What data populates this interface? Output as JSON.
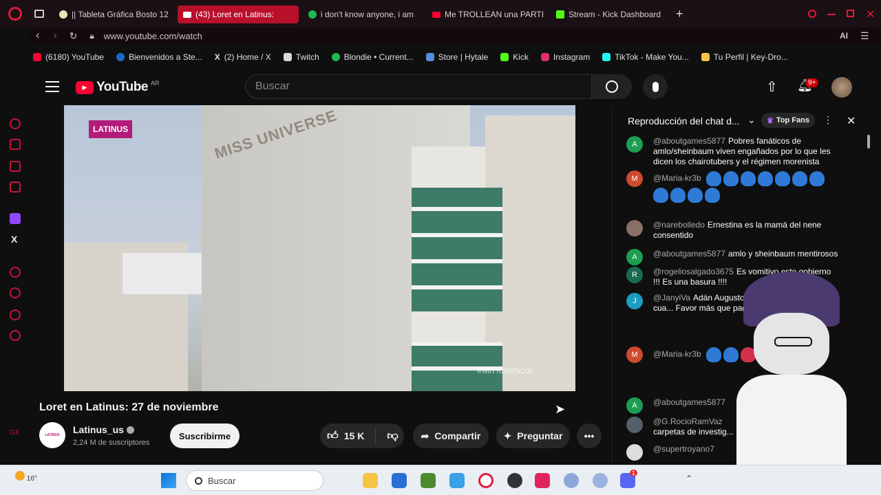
{
  "browser": {
    "tabs": [
      {
        "label": "|| Tableta Gráfica Bosto 12",
        "color": "#e8e3b8"
      },
      {
        "label": "(43) Loret en Latinus:",
        "color": "#ff0033",
        "active": true
      },
      {
        "label": "i don't know anyone, i am",
        "color": "#1db954"
      },
      {
        "label": "Me TROLLEAN una PARTI",
        "color": "#ff0033"
      },
      {
        "label": "Stream - Kick Dashboard",
        "color": "#53fc18"
      }
    ],
    "new_tab": "+",
    "url": "www.youtube.com/watch",
    "bookmarks": [
      {
        "label": "(6180) YouTube",
        "color": "#ff0033"
      },
      {
        "label": "Bienvenidos a Ste...",
        "color": "#1b6ac9"
      },
      {
        "label": "(2) Home / X",
        "color": "#ffffff"
      },
      {
        "label": "Twitch",
        "color": "#9146ff"
      },
      {
        "label": "Blondie • Current...",
        "color": "#1db954"
      },
      {
        "label": "Store | Hytale",
        "color": "#5b8ad6"
      },
      {
        "label": "Kick",
        "color": "#53fc18"
      },
      {
        "label": "Instagram",
        "color": "#e1306c"
      },
      {
        "label": "TikTok - Make You...",
        "color": "#25f4ee"
      },
      {
        "label": "Tu Perfil | Key-Dro...",
        "color": "#f5c542"
      }
    ],
    "ai_label": "AI"
  },
  "youtube": {
    "logo": "YouTube",
    "region": "AR",
    "search_placeholder": "Buscar",
    "notif_count": "9+",
    "video": {
      "watermark_brand": "LATINUS",
      "watermark_handle": "#MrHuachicol",
      "building_sign": "MISS UNIVERSE"
    },
    "title": "Loret en Latinus: 27 de noviembre",
    "channel": {
      "name": "Latinus_us",
      "subs": "2,24 M de suscriptores",
      "avatar_text": "LATINUS"
    },
    "subscribe": "Suscribirme",
    "likes": "15 K",
    "share": "Compartir",
    "ask": "Preguntar"
  },
  "chat": {
    "title": "Reproducción del chat d...",
    "top_fans": "Top Fans",
    "messages": [
      {
        "avatar": "A",
        "color": "#1e9e53",
        "author": "@aboutgames5877",
        "text": "Pobres fanáticos de amlo/sheinbaum viven engañados por lo que les dicen los chairotubers y el régimen morenista"
      },
      {
        "avatar": "M",
        "color": "#d04a2e",
        "author": "@Maria-kr3b",
        "text": ""
      },
      {
        "avatar": "",
        "color": "#8a6f69",
        "author": "@narebolledo",
        "text": "Ernestina es la mamá del nene consentido"
      },
      {
        "avatar": "A",
        "color": "#1e9e53",
        "author": "@aboutgames5877",
        "text": "amlo y sheinbaum mentirosos"
      },
      {
        "avatar": "R",
        "color": "#1b6b52",
        "author": "@rogeliosalgado3675",
        "text": "Es vomitivo este gobierno !!! Es una basura !!!!"
      },
      {
        "avatar": "J",
        "color": "#1a9dc0",
        "author": "@JanyiVa",
        "text": "Adán Augusto salvó al presidente Aml.o cua... Favor más que paga... Barredora"
      },
      {
        "avatar": "M",
        "color": "#d04a2e",
        "author": "@Maria-kr3b",
        "text": ""
      },
      {
        "avatar": "A",
        "color": "#1e9e53",
        "author": "@aboutgames5877",
        "text": ""
      },
      {
        "avatar": "",
        "color": "#55606a",
        "author": "@G.RocioRamVaz",
        "text": "carpetas de investig..."
      },
      {
        "avatar": "",
        "color": "#dddddd",
        "author": "@supertroyano7",
        "text": ""
      }
    ]
  },
  "taskbar": {
    "weather": "16°",
    "search": "Buscar",
    "discord_badge": "1"
  }
}
